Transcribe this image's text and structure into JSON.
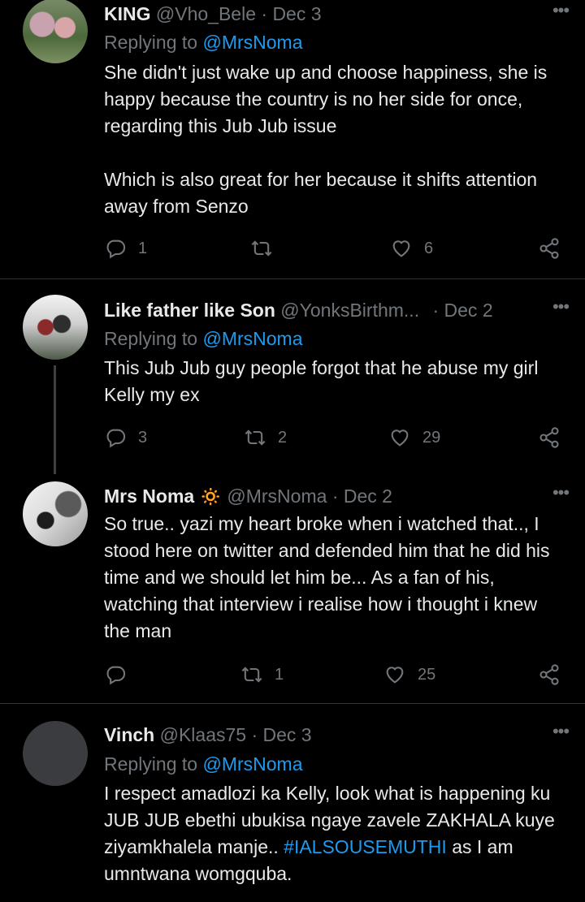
{
  "tweets": [
    {
      "name": "KING",
      "handle": "@Vho_Bele",
      "date": "· Dec 3",
      "replying_prefix": "Replying to ",
      "replying_to": "@MrsNoma",
      "text": "She didn't just wake up and choose happiness, she is happy because the country is no her side for once, regarding this Jub Jub issue\n\nWhich is also great for her because it shifts attention away from Senzo",
      "replies": "1",
      "retweets": "",
      "likes": "6"
    },
    {
      "name": "Like father like Son",
      "handle": "@YonksBirthm...",
      "date": "· Dec 2",
      "replying_prefix": "Replying to ",
      "replying_to": "@MrsNoma",
      "text": "This Jub Jub guy people forgot that he abuse my girl Kelly my ex",
      "replies": "3",
      "retweets": "2",
      "likes": "29"
    },
    {
      "name": "Mrs Noma",
      "name_emoji": "🔅",
      "handle": "@MrsNoma",
      "date": "· Dec 2",
      "text": "So true.. yazi my heart broke when i watched that.., I stood here on twitter and defended him that he did his time and we should let him be... As a fan of his, watching that interview i realise how i thought i knew the man",
      "replies": "",
      "retweets": "1",
      "likes": "25"
    },
    {
      "name": "Vinch",
      "handle": "@Klaas75",
      "date": "· Dec 3",
      "replying_prefix": "Replying to ",
      "replying_to": "@MrsNoma",
      "text_before": "I respect amadlozi ka Kelly, look what is happening ku JUB JUB ebethi ubukisa ngaye zavele ZAKHALA kuye ziyamkhalela manje.. ",
      "hashtag": "#IALSOUSEMUTHI",
      "text_after": " as I am umntwana womgquba."
    }
  ],
  "more_label": "•••",
  "colors": {
    "accent": "#1d9bf0",
    "muted": "#71767b",
    "background": "#000000"
  },
  "icons": [
    "reply-icon",
    "retweet-icon",
    "like-icon",
    "share-icon",
    "more-icon"
  ]
}
